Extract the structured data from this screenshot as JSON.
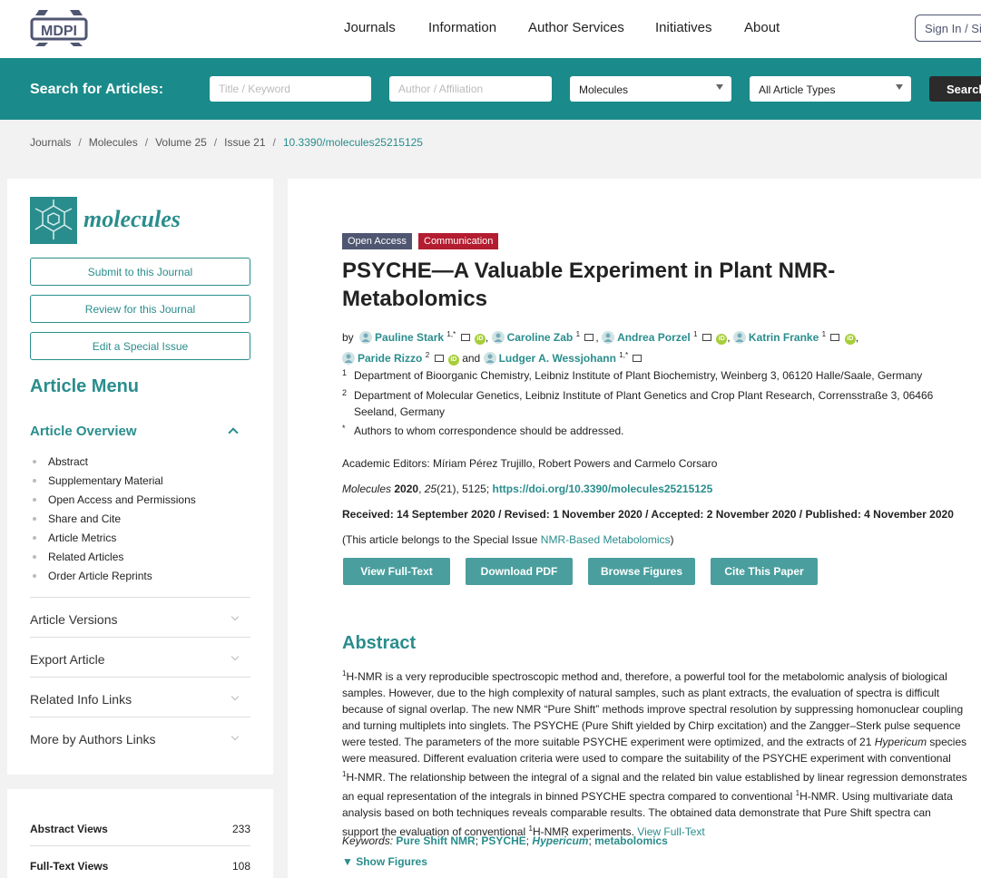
{
  "nav": {
    "logo": "MDPI",
    "items": [
      "Journals",
      "Information",
      "Author Services",
      "Initiatives",
      "About"
    ],
    "signin": "Sign In / Sign Up"
  },
  "search": {
    "label": "Search for Articles:",
    "title_placeholder": "Title / Keyword",
    "author_placeholder": "Author / Affiliation",
    "journal_value": "Molecules",
    "type_value": "All Article Types",
    "button": "Search"
  },
  "breadcrumb": [
    "Journals",
    "Molecules",
    "Volume 25",
    "Issue 21",
    "10.3390/molecules25215125"
  ],
  "sidebar": {
    "journal_name": "molecules",
    "buttons": [
      "Submit to this Journal",
      "Review for this Journal",
      "Edit a Special Issue"
    ],
    "menu_title": "Article Menu",
    "overview_title": "Article Overview",
    "overview_items": [
      "Abstract",
      "Supplementary Material",
      "Open Access and Permissions",
      "Share and Cite",
      "Article Metrics",
      "Related Articles",
      "Order Article Reprints"
    ],
    "accordions": [
      "Article Versions",
      "Export Article",
      "Related Info Links",
      "More by Authors Links"
    ],
    "stats": [
      {
        "label": "Abstract Views",
        "value": "233"
      },
      {
        "label": "Full-Text Views",
        "value": "108"
      }
    ]
  },
  "article": {
    "badge_open": "Open Access",
    "badge_type": "Communication",
    "title": "PSYCHE—A Valuable Experiment in Plant NMR-Metabolomics",
    "by": "by",
    "authors": [
      {
        "name": "Pauline Stark",
        "sup": "1,*"
      },
      {
        "name": "Caroline Zab",
        "sup": "1"
      },
      {
        "name": "Andrea Porzel",
        "sup": "1"
      },
      {
        "name": "Katrin Franke",
        "sup": "1"
      },
      {
        "name": "Paride Rizzo",
        "sup": "2"
      },
      {
        "name": "Ludger A. Wessjohann",
        "sup": "1,*"
      }
    ],
    "and": "and",
    "affiliations": [
      {
        "num": "1",
        "text": "Department of Bioorganic Chemistry, Leibniz Institute of Plant Biochemistry, Weinberg 3, 06120 Halle/Saale, Germany"
      },
      {
        "num": "2",
        "text": "Department of Molecular Genetics, Leibniz Institute of Plant Genetics and Crop Plant Research, Corrensstraße 3, 06466 Seeland, Germany"
      },
      {
        "num": "*",
        "text": "Authors to whom correspondence should be addressed."
      }
    ],
    "editors": "Academic Editors: Míriam Pérez Trujillo, Robert Powers and Carmelo Corsaro",
    "citation_journal": "Molecules",
    "citation_year": "2020",
    "citation_vol": "25",
    "citation_rest": "(21), 5125; ",
    "doi_link": "https://doi.org/10.3390/molecules25215125",
    "dates": "Received: 14 September 2020 / Revised: 1 November 2020 / Accepted: 2 November 2020 / Published: 4 November 2020",
    "special_prefix": "(This article belongs to the Special Issue ",
    "special_link": "NMR-Based Metabolomics",
    "special_suffix": ")",
    "buttons": [
      "View Full-Text",
      "Download PDF",
      "Browse Figures",
      "Cite This Paper"
    ],
    "abstract_heading": "Abstract",
    "abstract_1": "H-NMR is a very reproducible spectroscopic method and, therefore, a powerful tool for the metabolomic analysis of biological samples. However, due to the high complexity of natural samples, such as plant extracts, the evaluation of spectra is difficult because of signal overlap. The new NMR “Pure Shift” methods improve spectral resolution by suppressing homonuclear coupling and turning multiplets into singlets. The PSYCHE (Pure Shift yielded by Chirp excitation) and the Zangger–Sterk pulse sequence were tested. The parameters of the more suitable PSYCHE experiment were optimized, and the extracts of 21 ",
    "abstract_italic": "Hypericum",
    "abstract_2": " species were measured. Different evaluation criteria were used to compare the suitability of the PSYCHE experiment with conventional ",
    "abstract_3": "H-NMR. The relationship between the integral of a signal and the related bin value established by linear regression demonstrates an equal representation of the integrals in binned PSYCHE spectra compared to conventional ",
    "abstract_4": "H-NMR. Using multivariate data analysis based on both techniques reveals comparable results. The obtained data demonstrate that Pure Shift spectra can support the evaluation of conventional ",
    "abstract_5": "H-NMR experiments. ",
    "abstract_sup": "1",
    "view_full_text": "View Full-Text",
    "keywords_label": "Keywords:",
    "keywords": [
      "Pure Shift NMR",
      "PSYCHE",
      "Hypericum",
      "metabolomics"
    ],
    "show_figures": "▼ Show Figures"
  }
}
